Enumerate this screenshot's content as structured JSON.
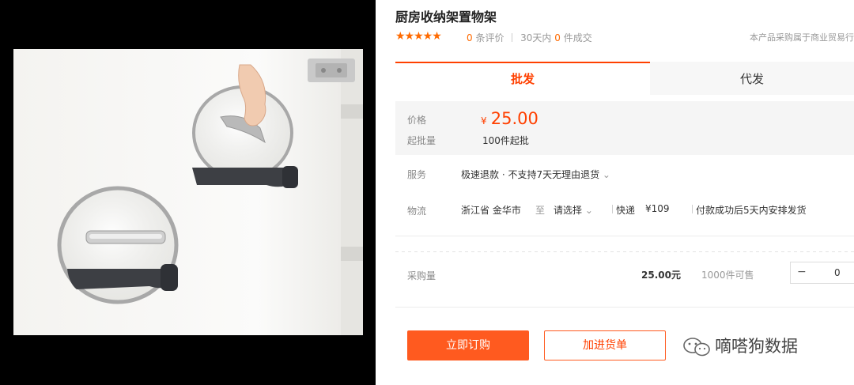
{
  "product": {
    "title": "厨房收纳架置物架",
    "stars": "★★★★★",
    "review_count": "0",
    "review_label": "条评价",
    "sales_period": "30天内",
    "sales_count": "0",
    "sales_label": "件成交",
    "trade_note": "本产品采购属于商业贸易行"
  },
  "tabs": [
    {
      "label": "批发",
      "active": true
    },
    {
      "label": "代发",
      "active": false
    }
  ],
  "pricing": {
    "price_label": "价格",
    "currency": "¥",
    "price": "25.00",
    "moq_label": "起批量",
    "moq": "100件起批"
  },
  "service": {
    "label": "服务",
    "value": "极速退款 · 不支持7天无理由退货",
    "icon": "chevron-down-icon"
  },
  "logistics": {
    "label": "物流",
    "origin": "浙江省 金华市",
    "to": "至",
    "destination": "请选择",
    "carrier": "快递",
    "fee": "¥109",
    "dispatch_note": "付款成功后5天内安排发货"
  },
  "purchase": {
    "label": "采购量",
    "subtotal": "25.00元",
    "available": "1000件可售",
    "minus": "−",
    "quantity": "0"
  },
  "actions": {
    "buy_now": "立即订购",
    "add_to_cart": "加进货单"
  },
  "watermark": {
    "text": "嘀嗒狗数据",
    "icon": "wechat-icon"
  },
  "colors": {
    "accent": "#ff4000",
    "button": "#ff5a1f",
    "star": "#ff6a00"
  }
}
